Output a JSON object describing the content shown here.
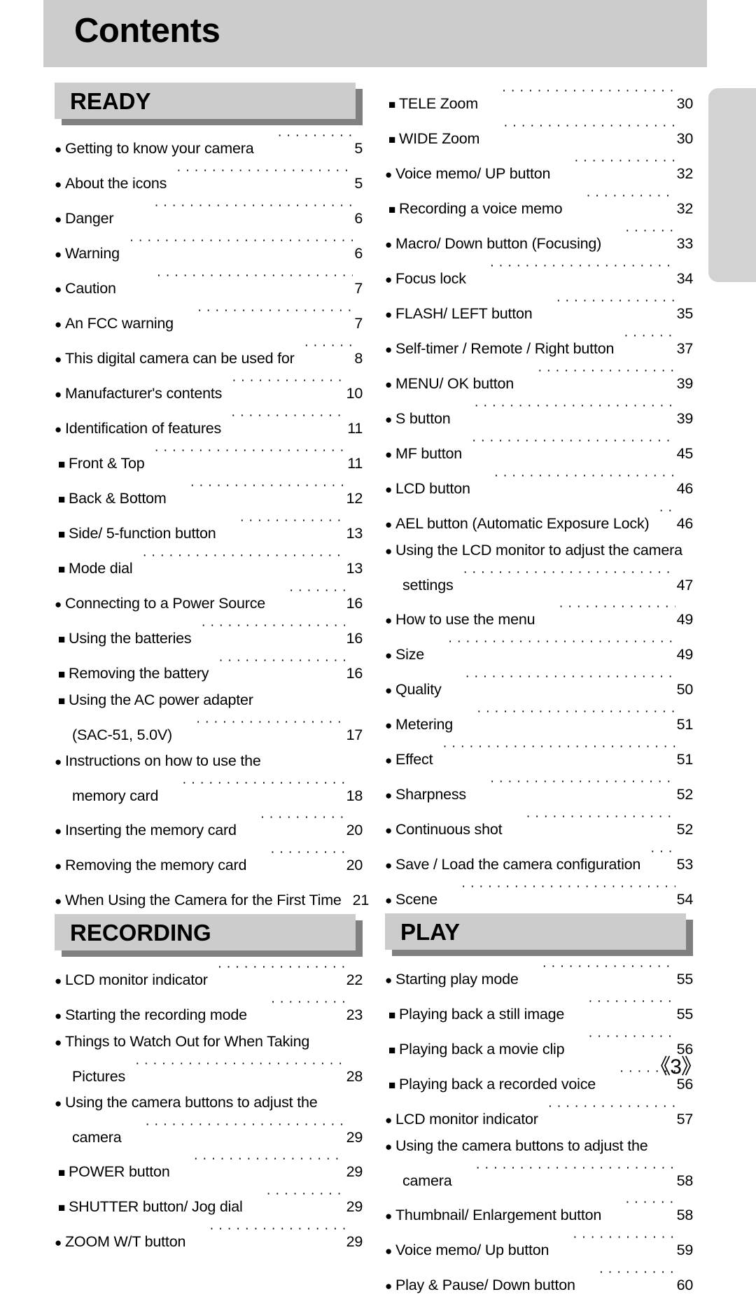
{
  "document": {
    "title": "Contents",
    "page_number": "《3》"
  },
  "colors": {
    "band_gray": "#cccccc",
    "bar_face": "#cccccc",
    "bar_shadow": "#808080",
    "edge_tab": "#d2d2d2",
    "text": "#000000"
  },
  "bullets": {
    "level1": "●",
    "level2": "■",
    "continuation": ""
  },
  "columns": [
    {
      "id": "left",
      "sections": [
        {
          "heading": "READY",
          "entries": [
            {
              "level": 1,
              "label": "Getting to know your camera",
              "page": "5",
              "gap": "md"
            },
            {
              "level": 1,
              "label": "About the icons",
              "page": "5",
              "gap": "sm"
            },
            {
              "level": 1,
              "label": "Danger",
              "page": "6",
              "gap": "lg"
            },
            {
              "level": 1,
              "label": "Warning",
              "page": "6",
              "gap": "sm"
            },
            {
              "level": 1,
              "label": "Caution",
              "page": "7",
              "gap": "lg"
            },
            {
              "level": 1,
              "label": "An FCC warning",
              "page": "7",
              "gap": "md"
            },
            {
              "level": 1,
              "label": "This digital camera can be used for",
              "page": "8",
              "gap": "sm"
            },
            {
              "level": 1,
              "label": "Manufacturer's contents",
              "page": "10",
              "gap": "sm"
            },
            {
              "level": 1,
              "label": "Identification of features",
              "page": "11",
              "gap": "sm"
            },
            {
              "level": 2,
              "label": "Front & Top",
              "page": "11",
              "gap": "sm"
            },
            {
              "level": 2,
              "label": "Back & Bottom",
              "page": "12",
              "gap": "md"
            },
            {
              "level": 2,
              "label": "Side/ 5-function button",
              "page": "13",
              "gap": "md"
            },
            {
              "level": 2,
              "label": "Mode dial",
              "page": "13",
              "gap": "sm"
            },
            {
              "level": 1,
              "label": "Connecting to a Power Source",
              "page": "16",
              "gap": "md"
            },
            {
              "level": 2,
              "label": "Using the batteries",
              "page": "16",
              "gap": "sm"
            },
            {
              "level": 2,
              "label": "Removing the battery",
              "page": "16",
              "gap": "sm"
            },
            {
              "level": 2,
              "label": "Using the AC power adapter",
              "page": "",
              "gap": "sm",
              "nopage": true
            },
            {
              "level": 0,
              "label": "(SAC-51, 5.0V)",
              "page": "17",
              "gap": "md"
            },
            {
              "level": 1,
              "label": "Instructions on how to use the",
              "page": "",
              "gap": "sm",
              "nopage": true
            },
            {
              "level": 0,
              "label": "memory card",
              "page": "18",
              "gap": "md"
            },
            {
              "level": 1,
              "label": "Inserting the memory card",
              "page": "20",
              "gap": "md"
            },
            {
              "level": 1,
              "label": "Removing the memory card",
              "page": "20",
              "gap": "md"
            },
            {
              "level": 1,
              "label": "When Using the Camera for the First Time",
              "page": "21",
              "gap": "sm"
            }
          ]
        },
        {
          "heading": "RECORDING",
          "entries": [
            {
              "level": 1,
              "label": "LCD monitor indicator",
              "page": "22",
              "gap": "sm"
            },
            {
              "level": 1,
              "label": "Starting the recording mode",
              "page": "23",
              "gap": "md"
            },
            {
              "level": 1,
              "label": "Things to Watch Out for When Taking",
              "page": "",
              "gap": "sm",
              "nopage": true
            },
            {
              "level": 0,
              "label": "Pictures",
              "page": "28",
              "gap": "sm"
            },
            {
              "level": 1,
              "label": "Using the camera buttons to adjust the",
              "page": "",
              "gap": "sm",
              "nopage": true
            },
            {
              "level": 0,
              "label": "camera",
              "page": "29",
              "gap": "md"
            },
            {
              "level": 2,
              "label": "POWER button",
              "page": "29",
              "gap": "md"
            },
            {
              "level": 2,
              "label": "SHUTTER button/ Jog dial",
              "page": "29",
              "gap": "md"
            },
            {
              "level": 1,
              "label": "ZOOM W/T button",
              "page": "29",
              "gap": "md"
            }
          ]
        }
      ]
    },
    {
      "id": "right",
      "sections": [
        {
          "heading": "",
          "noheading": true,
          "entries": [
            {
              "level": 2,
              "label": "TELE Zoom",
              "page": "30",
              "gap": "md"
            },
            {
              "level": 2,
              "label": "WIDE Zoom",
              "page": "30",
              "gap": "md"
            },
            {
              "level": 1,
              "label": "Voice memo/ UP button",
              "page": "32",
              "gap": "md"
            },
            {
              "level": 2,
              "label": "Recording a voice memo",
              "page": "32",
              "gap": "md"
            },
            {
              "level": 1,
              "label": "Macro/ Down button (Focusing)",
              "page": "33",
              "gap": "md"
            },
            {
              "level": 1,
              "label": "Focus lock",
              "page": "34",
              "gap": "md"
            },
            {
              "level": 1,
              "label": "FLASH/ LEFT button",
              "page": "35",
              "gap": "md"
            },
            {
              "level": 1,
              "label": "Self-timer / Remote / Right button",
              "page": "37",
              "gap": "sm"
            },
            {
              "level": 1,
              "label": "MENU/ OK button",
              "page": "39",
              "gap": "md"
            },
            {
              "level": 1,
              "label": "S button",
              "page": "39",
              "gap": "md"
            },
            {
              "level": 1,
              "label": "MF button",
              "page": "45",
              "gap": "sm"
            },
            {
              "level": 1,
              "label": "LCD button",
              "page": "46",
              "gap": "md"
            },
            {
              "level": 1,
              "label": "AEL button (Automatic Exposure Lock)",
              "page": "46",
              "gap": "sm"
            },
            {
              "level": 1,
              "label": "Using the LCD monitor to adjust the camera",
              "page": "",
              "gap": "sm",
              "nopage": true
            },
            {
              "level": 0,
              "label": "settings",
              "page": "47",
              "gap": "sm"
            },
            {
              "level": 1,
              "label": "How to use the menu",
              "page": "49",
              "gap": "md"
            },
            {
              "level": 1,
              "label": "Size",
              "page": "49",
              "gap": "md"
            },
            {
              "level": 1,
              "label": "Quality",
              "page": "50",
              "gap": "md"
            },
            {
              "level": 1,
              "label": "Metering",
              "page": "51",
              "gap": "md"
            },
            {
              "level": 1,
              "label": "Effect",
              "page": "51",
              "gap": "sm"
            },
            {
              "level": 1,
              "label": "Sharpness",
              "page": "52",
              "gap": "md"
            },
            {
              "level": 1,
              "label": "Continuous shot",
              "page": "52",
              "gap": "md"
            },
            {
              "level": 1,
              "label": "Save / Load the camera configuration",
              "page": "53",
              "gap": "sm"
            },
            {
              "level": 1,
              "label": "Scene",
              "page": "54",
              "gap": "md"
            }
          ]
        },
        {
          "heading": "PLAY",
          "entries": [
            {
              "level": 1,
              "label": "Starting play mode",
              "page": "55",
              "gap": "md"
            },
            {
              "level": 2,
              "label": "Playing back a still image",
              "page": "55",
              "gap": "md"
            },
            {
              "level": 2,
              "label": "Playing back a movie clip",
              "page": "56",
              "gap": "md"
            },
            {
              "level": 2,
              "label": "Playing back a recorded voice",
              "page": "56",
              "gap": "md"
            },
            {
              "level": 1,
              "label": "LCD monitor indicator",
              "page": "57",
              "gap": "sm"
            },
            {
              "level": 1,
              "label": "Using the camera buttons to adjust the",
              "page": "",
              "gap": "sm",
              "nopage": true
            },
            {
              "level": 0,
              "label": "camera",
              "page": "58",
              "gap": "md"
            },
            {
              "level": 1,
              "label": "Thumbnail/ Enlargement button",
              "page": "58",
              "gap": "md"
            },
            {
              "level": 1,
              "label": "Voice memo/ Up button",
              "page": "59",
              "gap": "md"
            },
            {
              "level": 1,
              "label": "Play & Pause/ Down button",
              "page": "60",
              "gap": "md"
            }
          ]
        }
      ]
    }
  ]
}
